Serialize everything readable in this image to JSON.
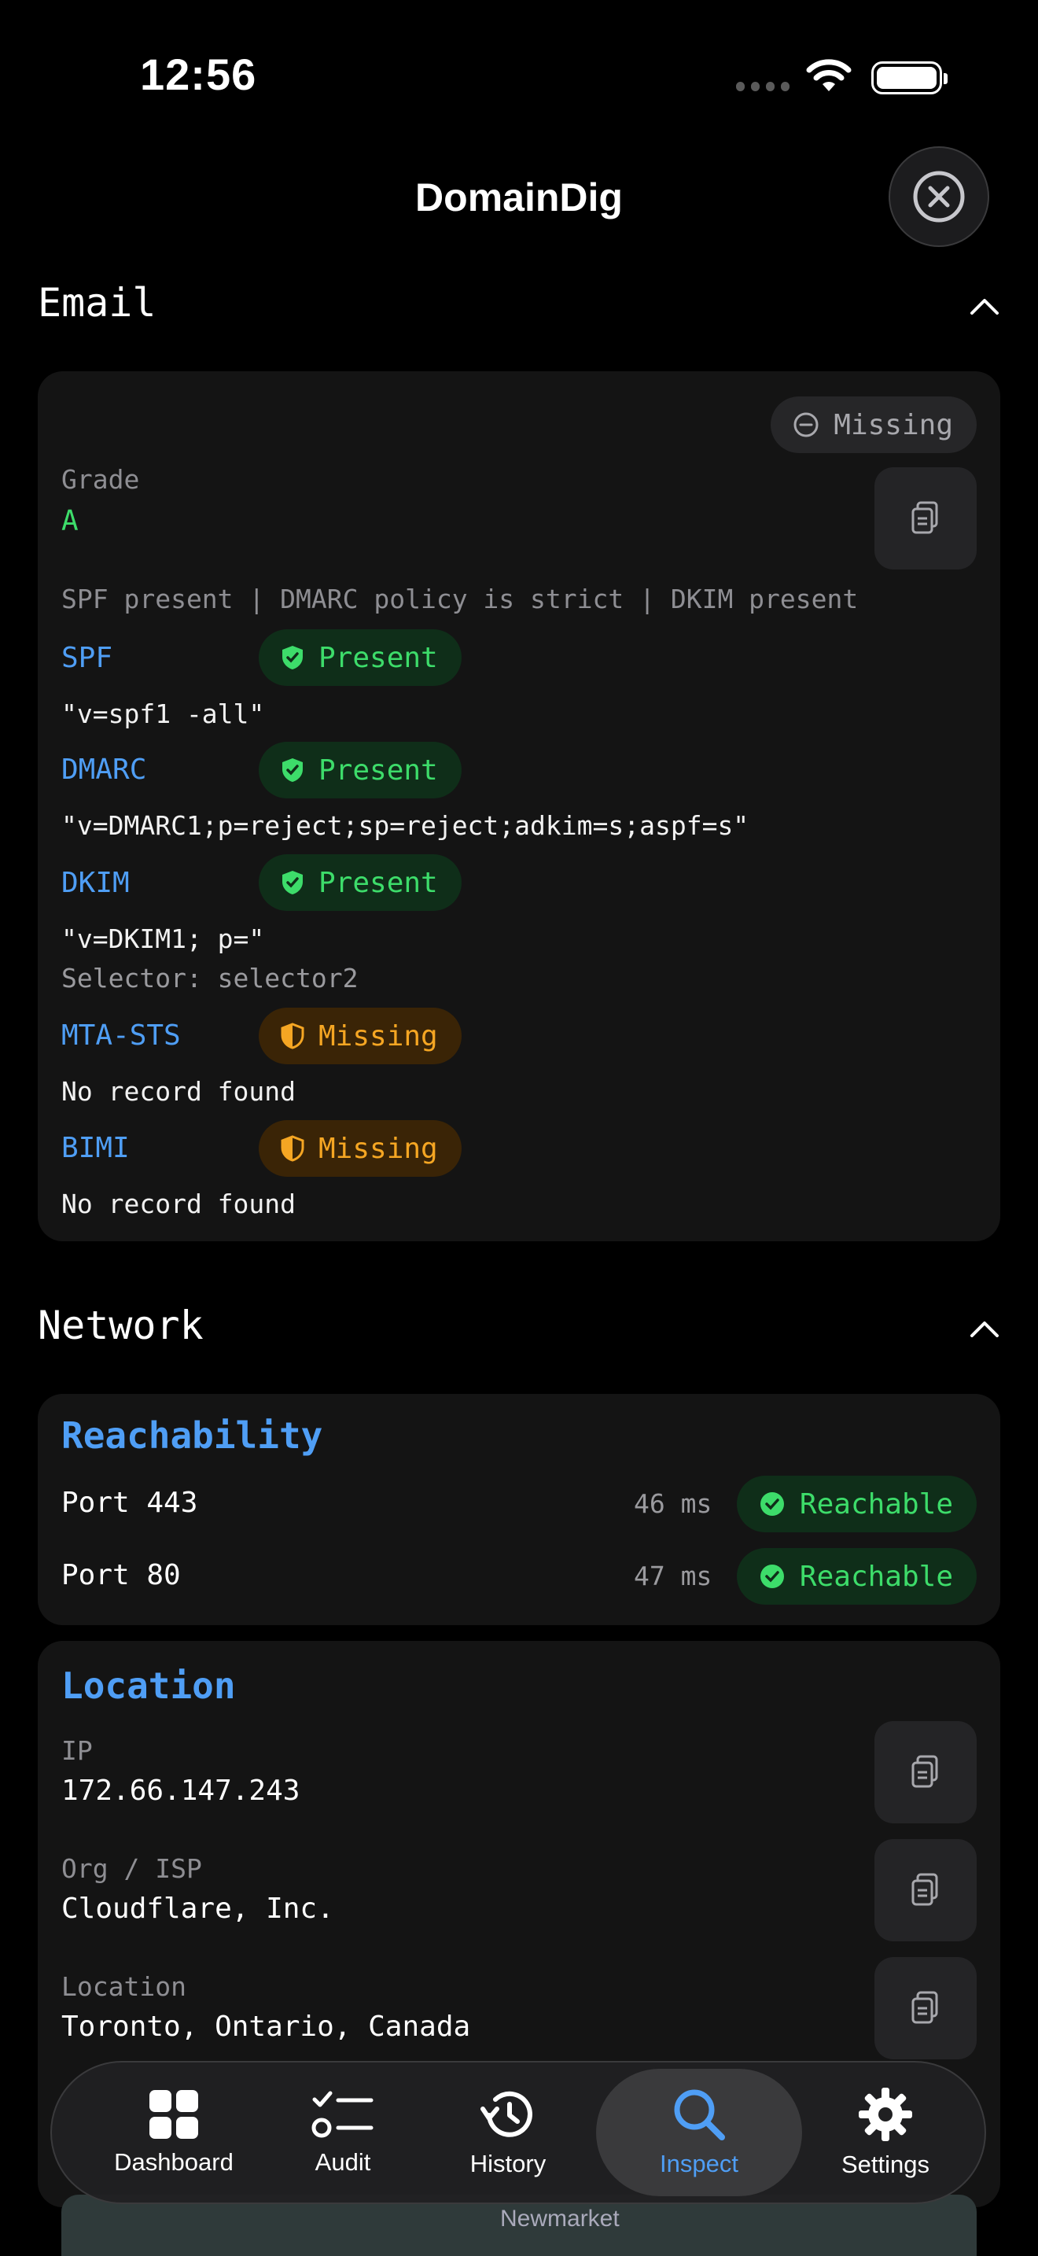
{
  "status": {
    "time": "12:56"
  },
  "nav": {
    "title": "DomainDig"
  },
  "email": {
    "section_title": "Email",
    "overall_badge": "Missing",
    "grade_label": "Grade",
    "grade_value": "A",
    "summary": "SPF present | DMARC policy is strict | DKIM present",
    "records": [
      {
        "name": "SPF",
        "status": "Present",
        "line": "\"v=spf1 -all\""
      },
      {
        "name": "DMARC",
        "status": "Present",
        "line": "\"v=DMARC1;p=reject;sp=reject;adkim=s;aspf=s\""
      },
      {
        "name": "DKIM",
        "status": "Present",
        "line": "\"v=DKIM1; p=\"",
        "sub": "Selector: selector2"
      },
      {
        "name": "MTA-STS",
        "status": "Missing",
        "line": "No record found"
      },
      {
        "name": "BIMI",
        "status": "Missing",
        "line": "No record found"
      }
    ]
  },
  "network": {
    "section_title": "Network",
    "reachability": {
      "title": "Reachability",
      "ports": [
        {
          "label": "Port 443",
          "latency": "46 ms",
          "status": "Reachable"
        },
        {
          "label": "Port 80",
          "latency": "47 ms",
          "status": "Reachable"
        }
      ]
    },
    "location": {
      "title": "Location",
      "fields": [
        {
          "label": "IP",
          "value": "172.66.147.243"
        },
        {
          "label": "Org / ISP",
          "value": "Cloudflare, Inc."
        },
        {
          "label": "Location",
          "value": "Toronto, Ontario, Canada"
        }
      ]
    }
  },
  "tabbar": {
    "tabs": [
      {
        "label": "Dashboard",
        "icon": "grid-icon"
      },
      {
        "label": "Audit",
        "icon": "checklist-icon"
      },
      {
        "label": "History",
        "icon": "history-icon"
      },
      {
        "label": "Inspect",
        "icon": "magnifier-icon",
        "active": true
      },
      {
        "label": "Settings",
        "icon": "gear-icon"
      }
    ]
  },
  "map": {
    "place": "Newmarket"
  },
  "colors": {
    "accent": "#4f9ef5",
    "present": "#3ddc6a",
    "missing": "#f5a623",
    "card": "#141414"
  }
}
